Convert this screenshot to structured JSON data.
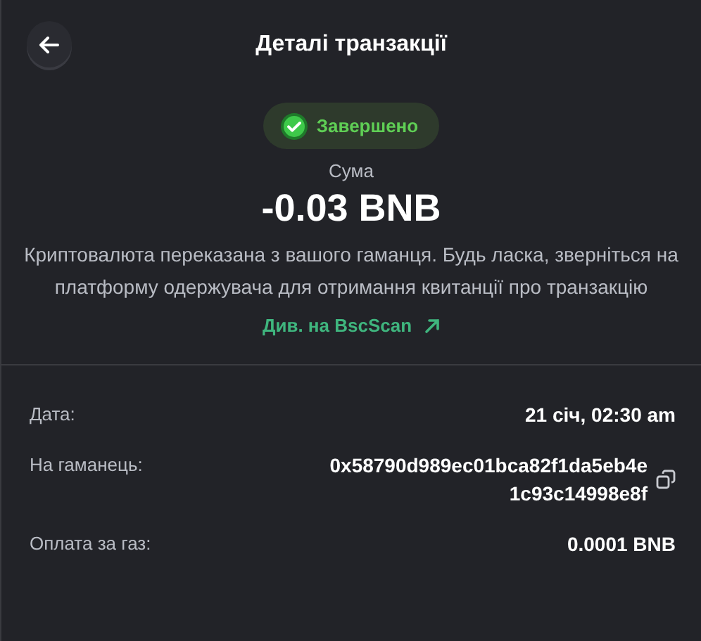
{
  "header": {
    "title": "Деталі транзакції"
  },
  "status": {
    "label": "Завершено",
    "kind": "completed"
  },
  "amount": {
    "label": "Сума",
    "value": "-0.03 BNB"
  },
  "description": "Криптовалюта переказана з вашого гаманця. Будь ласка, зверніться на платформу одержувача для отримання квитанції про транзакцію",
  "explorer_link": "Див. на BscScan",
  "details": [
    {
      "label": "Дата:",
      "value": "21 січ, 02:30 am",
      "copyable": false
    },
    {
      "label": "На гаманець:",
      "value": "0x58790d989ec01bca82f1da5eb4e1c93c14998e8f",
      "copyable": true
    },
    {
      "label": "Оплата за газ:",
      "value": "0.0001 BNB",
      "copyable": false
    }
  ]
}
